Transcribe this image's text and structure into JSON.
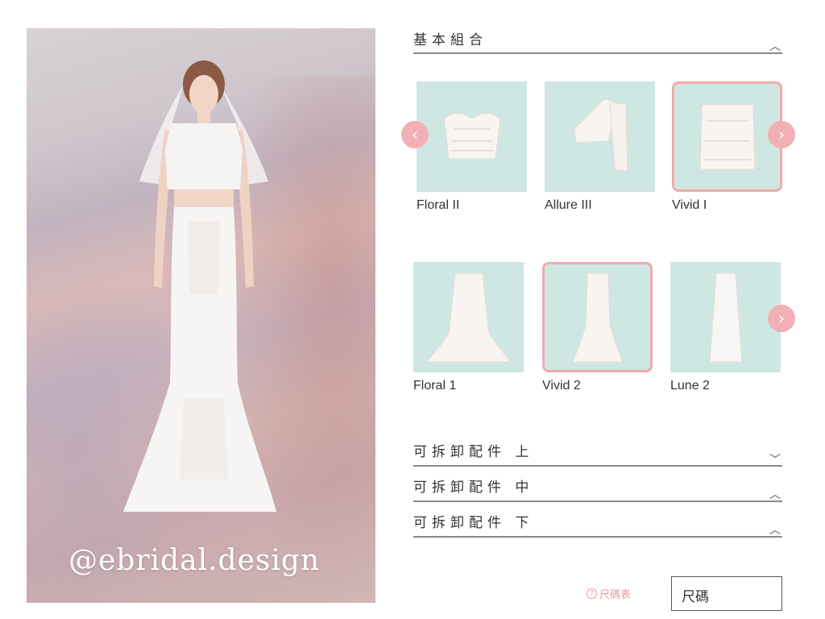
{
  "preview": {
    "watermark": "@ebridal.design"
  },
  "basic_set": {
    "title": "基本組合",
    "tops": [
      {
        "label": "Floral II",
        "selected": false
      },
      {
        "label": "Allure III",
        "selected": false
      },
      {
        "label": "Vivid I",
        "selected": true
      }
    ],
    "bottoms": [
      {
        "label": "Floral 1",
        "selected": false
      },
      {
        "label": "Vivid 2",
        "selected": true
      },
      {
        "label": "Lune 2",
        "selected": false
      }
    ]
  },
  "accessories": [
    {
      "title": "可拆卸配件 上",
      "state": "collapsed"
    },
    {
      "title": "可拆卸配件 中",
      "state": "expanded"
    },
    {
      "title": "可拆卸配件 下",
      "state": "expanded"
    }
  ],
  "size_chart_link": "尺碼表",
  "size_select": "尺碼",
  "colors": {
    "accent_pink": "#f1b0b5",
    "thumb_bg": "#cfe7e2"
  }
}
